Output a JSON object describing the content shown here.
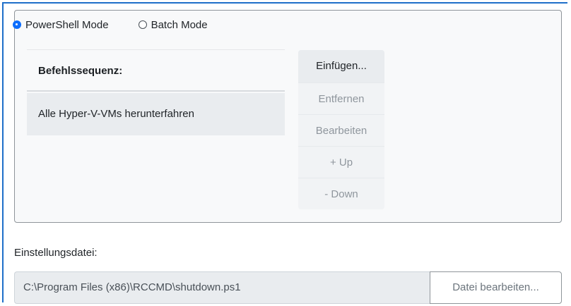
{
  "modes": {
    "powershell_label": "PowerShell Mode",
    "batch_label": "Batch Mode",
    "selected": "powershell"
  },
  "sequence": {
    "header": "Befehlssequenz:",
    "items": [
      "Alle Hyper-V-VMs herunterfahren"
    ]
  },
  "buttons": {
    "insert": "Einfügen...",
    "remove": "Entfernen",
    "edit": "Bearbeiten",
    "up": "+ Up",
    "down": "- Down"
  },
  "settings": {
    "label": "Einstellungsdatei:",
    "path": "C:\\Program Files (x86)\\RCCMD\\shutdown.ps1",
    "edit_button": "Datei bearbeiten..."
  },
  "colors": {
    "accent": "#0d6efd",
    "focus_border": "#1e6fc9"
  }
}
